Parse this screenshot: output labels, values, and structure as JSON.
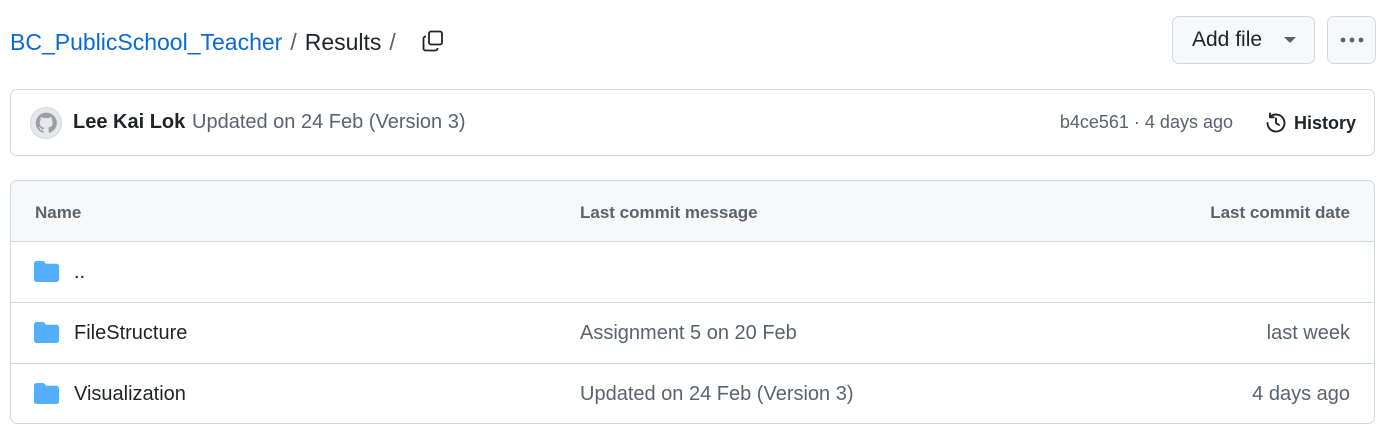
{
  "breadcrumb": {
    "repo": "BC_PublicSchool_Teacher",
    "separator": "/",
    "current": "Results",
    "trailing_separator": "/"
  },
  "actions": {
    "copy_icon": "copy-icon",
    "add_file_label": "Add file",
    "more_icon": "kebab-horizontal-icon"
  },
  "latest_commit": {
    "author": "Lee Kai Lok",
    "message": "Updated on 24 Feb (Version 3)",
    "hash": "b4ce561",
    "dot": "·",
    "time": "4 days ago",
    "history_label": "History"
  },
  "table": {
    "headers": {
      "name": "Name",
      "message": "Last commit message",
      "date": "Last commit date"
    },
    "rows": [
      {
        "name": "..",
        "message": "",
        "date": "",
        "icon": "folder-icon"
      },
      {
        "name": "FileStructure",
        "message": "Assignment 5 on 20 Feb",
        "date": "last week",
        "icon": "folder-icon"
      },
      {
        "name": "Visualization",
        "message": "Updated on 24 Feb (Version 3)",
        "date": "4 days ago",
        "icon": "folder-icon"
      }
    ]
  },
  "colors": {
    "link": "#0969da",
    "folder": "#54aeff",
    "muted": "#59636e",
    "border": "#d1d9e0",
    "header_bg": "#f6f8fa"
  }
}
